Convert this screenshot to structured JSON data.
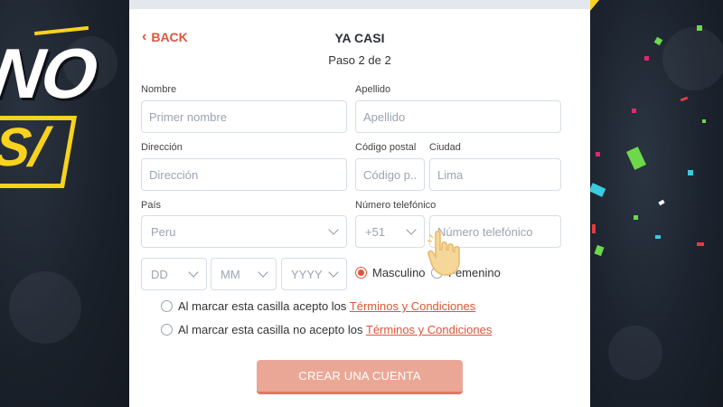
{
  "header": {
    "back_label": "BACK",
    "title": "YA CASI",
    "step": "Paso 2 de 2"
  },
  "form": {
    "nombre": {
      "label": "Nombre",
      "placeholder": "Primer nombre"
    },
    "apellido": {
      "label": "Apellido",
      "placeholder": "Apellido"
    },
    "direccion": {
      "label": "Dirección",
      "placeholder": "Dirección"
    },
    "codigo_postal": {
      "label": "Código postal",
      "placeholder": "Código p..."
    },
    "ciudad": {
      "label": "Ciudad",
      "placeholder": "Lima"
    },
    "pais": {
      "label": "País",
      "value": "Peru"
    },
    "telefono": {
      "label": "Número telefónico",
      "prefix": "+51",
      "placeholder": "Número telefónico"
    },
    "dob": {
      "day": "DD",
      "month": "MM",
      "year": "YYYY"
    },
    "gender": {
      "masculino": "Masculino",
      "femenino": "Femenino",
      "selected": "Masculino"
    },
    "terms_accept": {
      "text": "Al marcar esta casilla acepto los ",
      "link": "Términos y Condiciones"
    },
    "terms_reject": {
      "text": "Al marcar esta casilla no acepto los ",
      "link": "Términos y Condiciones"
    },
    "submit_label": "CREAR UNA CUENTA"
  },
  "promo": {
    "text_top": "NO",
    "text_bottom": "S/"
  },
  "colors": {
    "accent": "#e0543c",
    "cta": "#eba796",
    "promo_yellow": "#f7d21e"
  }
}
